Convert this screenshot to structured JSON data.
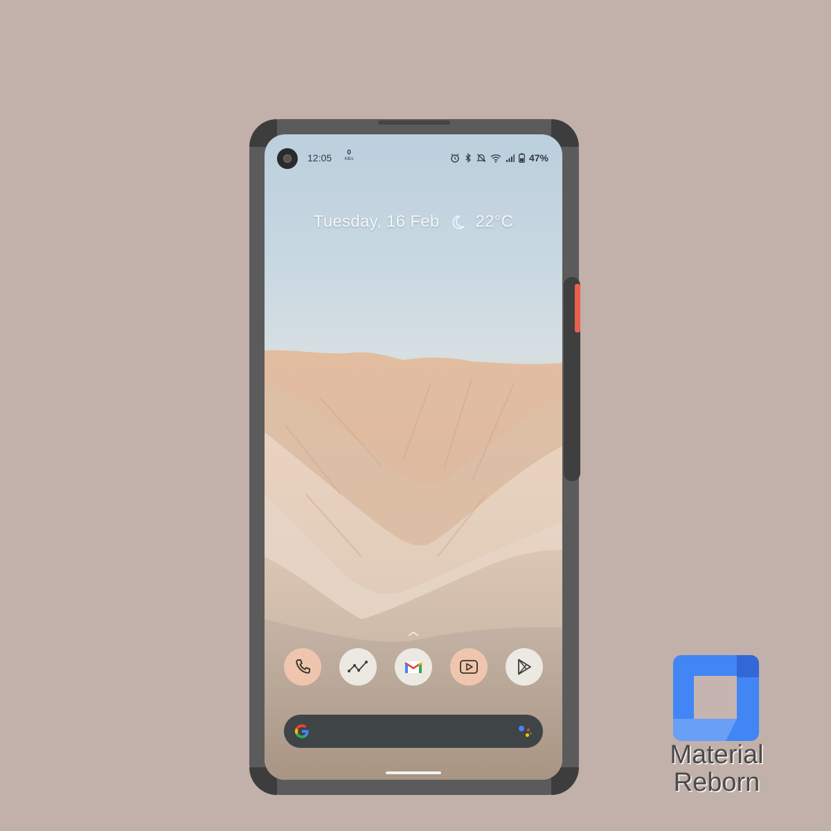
{
  "status_bar": {
    "time": "12:05",
    "net_speed_value": "0",
    "net_speed_unit": "KB/s",
    "battery_percent": "47%",
    "icons": [
      "alarm-icon",
      "bluetooth-icon",
      "silent-icon",
      "wifi-icon",
      "signal-icon",
      "battery-icon"
    ]
  },
  "date_widget": {
    "date": "Tuesday, 16 Feb",
    "weather_icon": "moon-icon",
    "temperature": "22°C"
  },
  "dock": {
    "apps": [
      {
        "name": "phone",
        "icon": "phone-icon",
        "color": "#efc6ad"
      },
      {
        "name": "stocks",
        "icon": "line-chart-icon",
        "color": "#ece9e2"
      },
      {
        "name": "gmail",
        "icon": "gmail-icon",
        "color": "#ece9e2"
      },
      {
        "name": "youtube",
        "icon": "play-box-icon",
        "color": "#efc6ad"
      },
      {
        "name": "play-store",
        "icon": "play-store-icon",
        "color": "#ece9e2"
      }
    ]
  },
  "search_bar": {
    "left_icon": "google-g-icon",
    "right_icon": "assistant-icon",
    "bar_color": "#3f4447"
  },
  "brand": {
    "line1": "Material",
    "line2": "Reborn",
    "logo_colors": [
      "#4285f4",
      "#3367d6",
      "#8ab4f8"
    ]
  },
  "colors": {
    "background": "#c2b0aa",
    "phone_frame": "#5b5b5b",
    "accent_button": "#e8614c"
  }
}
